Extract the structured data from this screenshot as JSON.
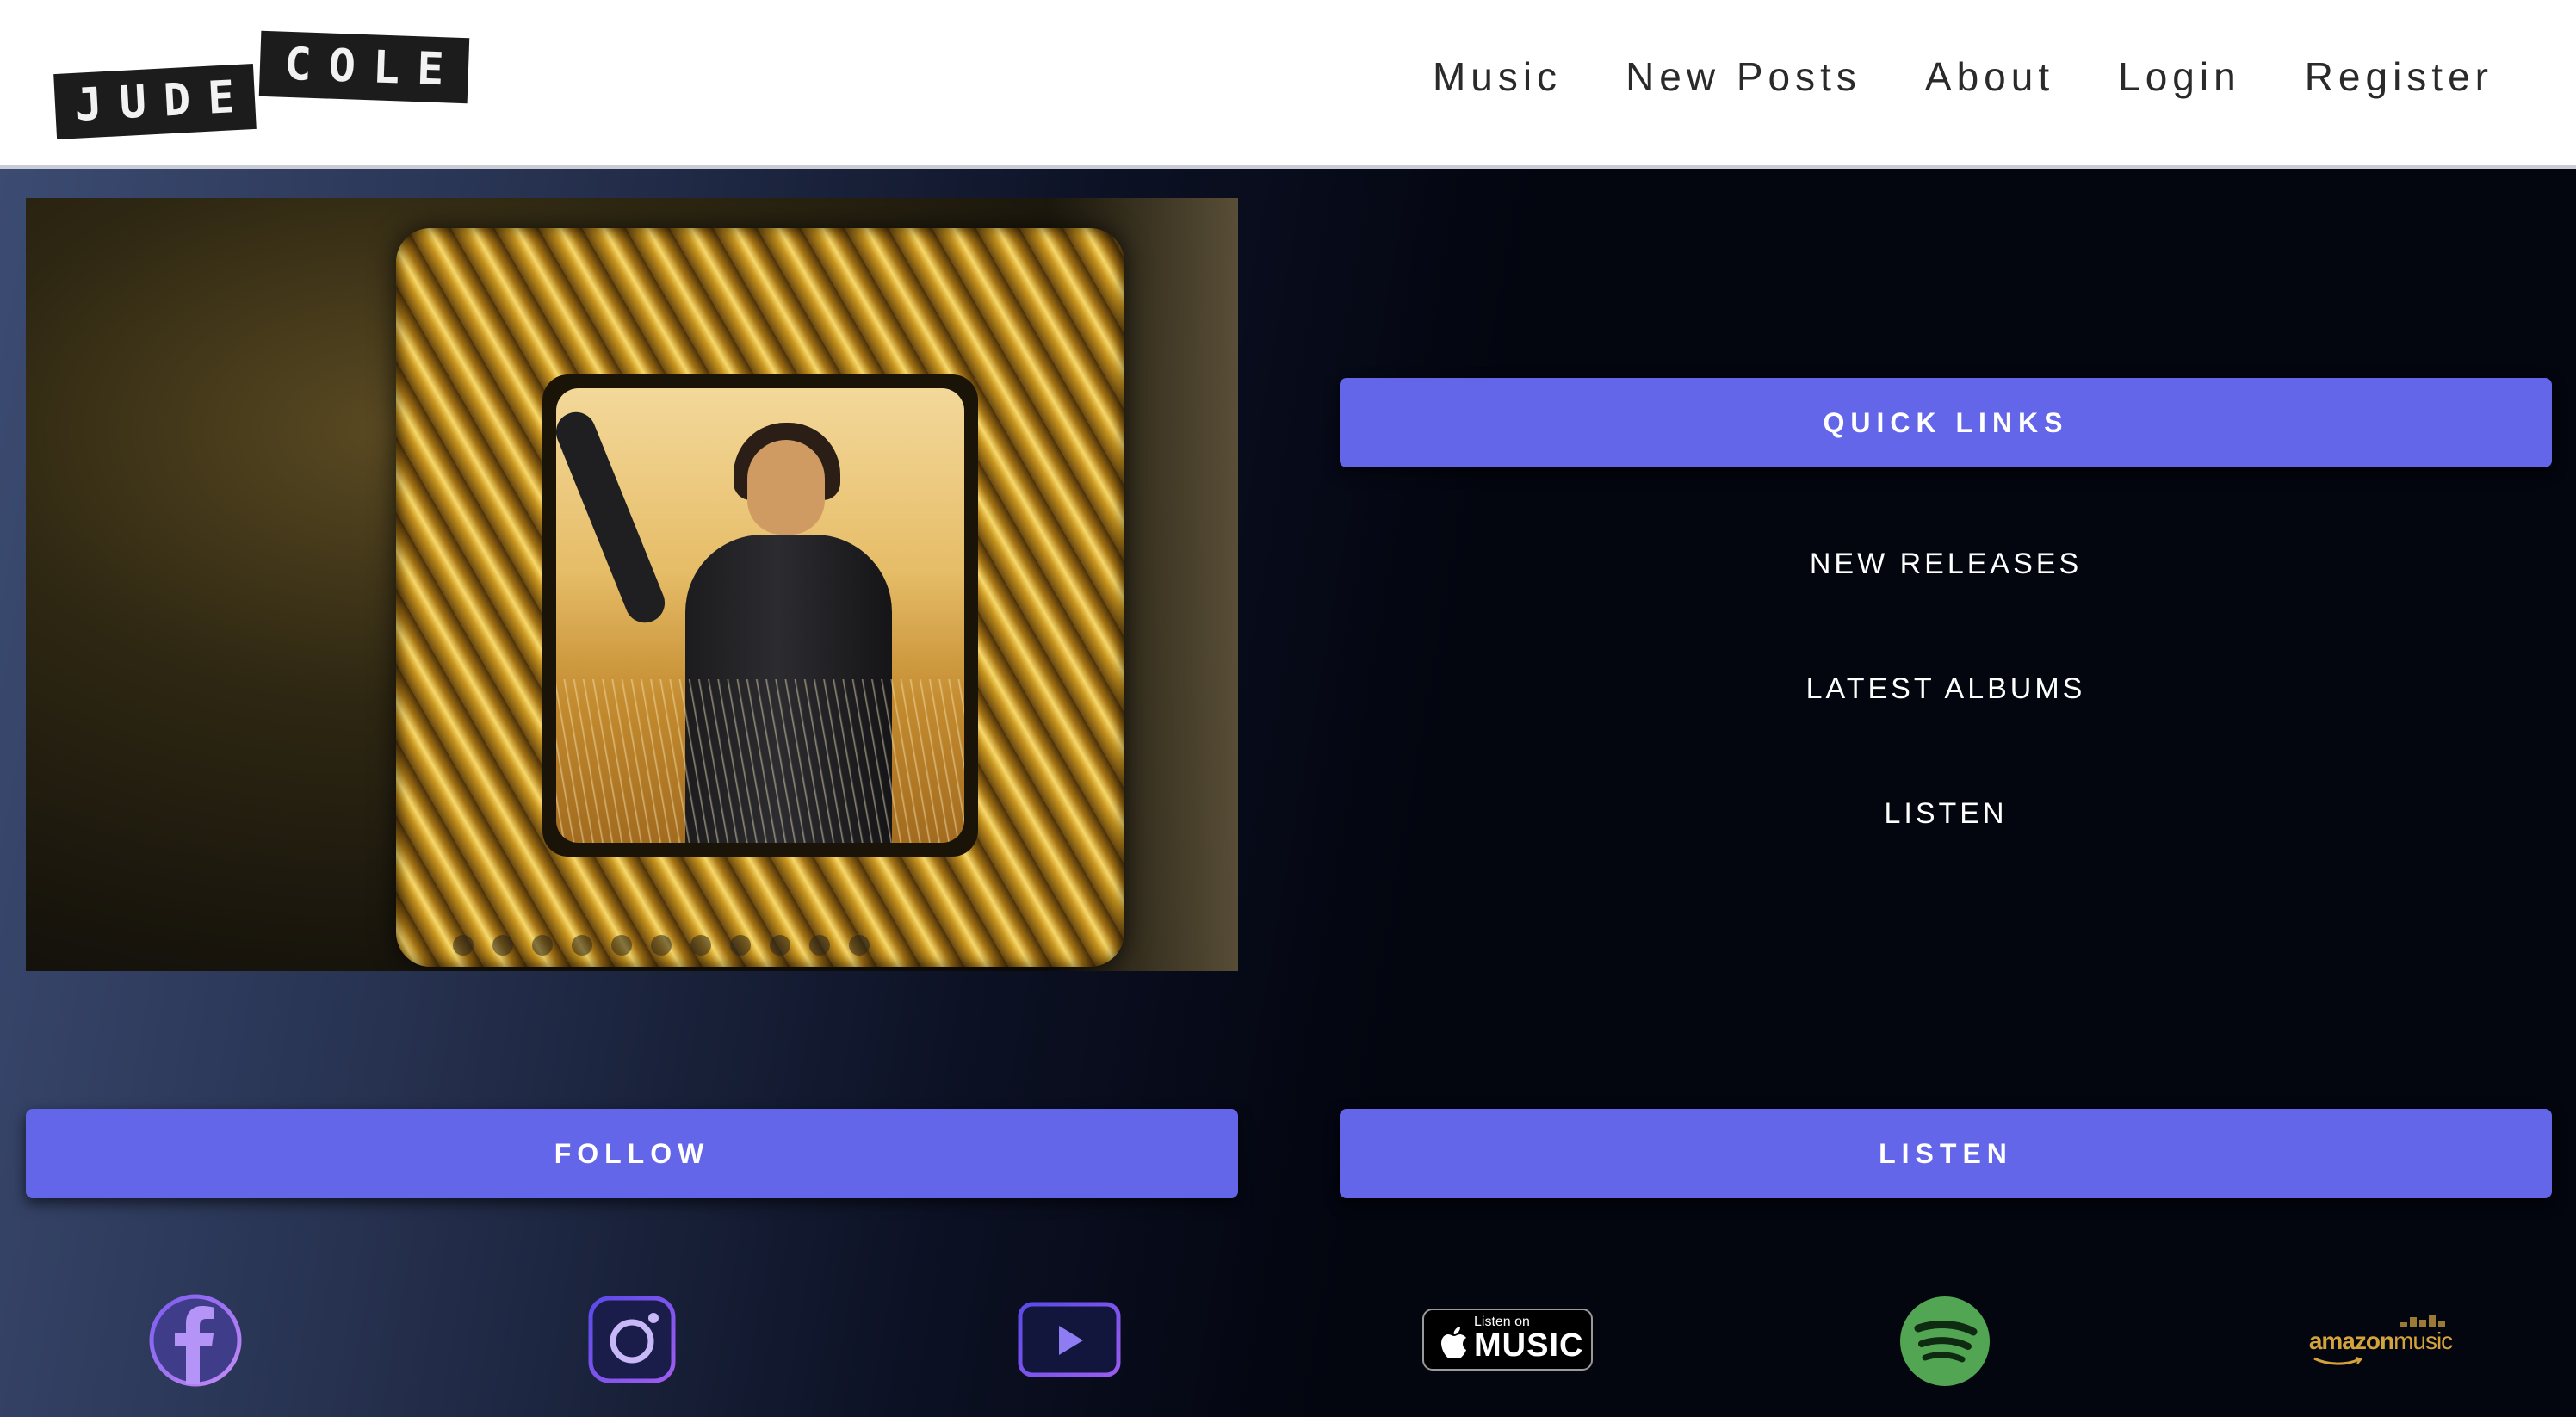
{
  "header": {
    "logo": {
      "word1": "JUDE",
      "word2": "COLE"
    },
    "nav": [
      "Music",
      "New Posts",
      "About",
      "Login",
      "Register"
    ]
  },
  "hero": {
    "slide_count": 11
  },
  "quick_links": {
    "title": "QUICK LINKS",
    "links": [
      "NEW RELEASES",
      "LATEST ALBUMS",
      "LISTEN"
    ]
  },
  "follow": {
    "label": "FOLLOW",
    "icons": [
      "facebook-icon",
      "instagram-icon",
      "youtube-icon"
    ]
  },
  "listen": {
    "label": "LISTEN",
    "apple_music": {
      "small": "Listen on",
      "big": "MUSIC"
    },
    "amazon": {
      "word1": "amazon",
      "word2": "music"
    },
    "icons": [
      "apple-music-icon",
      "spotify-icon",
      "amazon-music-icon"
    ]
  },
  "colors": {
    "accent": "#6366e8",
    "background": "#03050f",
    "spotify": "#52a653"
  }
}
